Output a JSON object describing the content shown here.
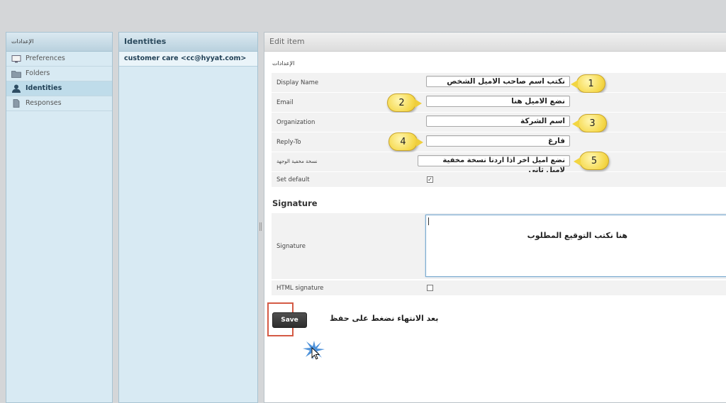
{
  "settings_panel": {
    "title": "الإعدادات",
    "items": [
      {
        "label": "Preferences",
        "icon": "monitor-icon"
      },
      {
        "label": "Folders",
        "icon": "folder-icon"
      },
      {
        "label": "Identities",
        "icon": "user-icon"
      },
      {
        "label": "Responses",
        "icon": "document-icon"
      }
    ],
    "selected": "Identities"
  },
  "identities_panel": {
    "title": "Identities",
    "items": [
      {
        "label": "customer care <cc@hyyat.com>"
      }
    ]
  },
  "edit_panel": {
    "title": "Edit item",
    "section": "الإعدادات",
    "fields": {
      "display_name": {
        "label": "Display Name",
        "value": "نكتب اسم صاحب الاميل الشخص",
        "callout": "1"
      },
      "email": {
        "label": "Email",
        "value": "نضع الاميل هنا",
        "callout": "2"
      },
      "organization": {
        "label": "Organization",
        "value": "اسم الشركة",
        "callout": "3"
      },
      "reply_to": {
        "label": "Reply-To",
        "value": "فارغ",
        "callout": "4"
      },
      "bcc": {
        "label": "نسخة مخفية الوجهة",
        "value": "نضع اميل اخر اذا اردنا نسخة مخفية لاميل ثاني",
        "callout": "5"
      },
      "set_default": {
        "label": "Set default",
        "checked": true
      }
    },
    "signature_section": {
      "title": "Signature",
      "signature_label": "Signature",
      "signature_value": "هنا نكتب التوقيع المطلوب",
      "html_signature_label": "HTML signature",
      "html_signature_checked": false
    },
    "save_label": "Save",
    "save_hint": "بعد الانتهاء نضغط على حفظ"
  },
  "colors": {
    "highlight_border": "#d45a45",
    "callout_fill": "#f5d84a",
    "panel_bg": "#d8eaf3"
  }
}
